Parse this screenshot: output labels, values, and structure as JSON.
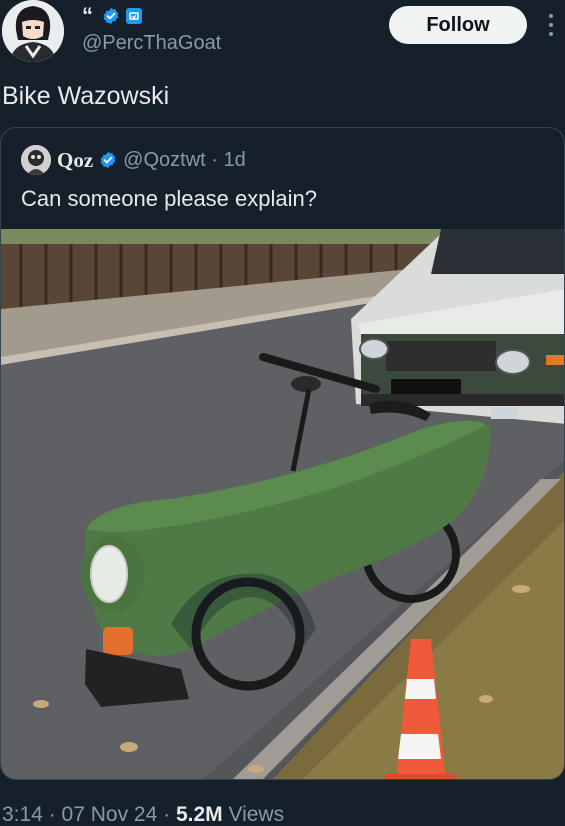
{
  "author": {
    "handle": "@PercThaGoat",
    "badge_icons": [
      "quote-mark-icon",
      "verified-badge-icon",
      "square-badge-icon"
    ],
    "follow_label": "Follow"
  },
  "tweet": {
    "text": "Bike Wazowski"
  },
  "quoted": {
    "name": "Qoz",
    "handle_time": "@Qoztwt · 1d",
    "text": "Can someone please explain?",
    "image": "photo of a green car-front shaped bicycle fairing on a street next to a white car and a traffic cone"
  },
  "meta": {
    "time_date": "3:14 · 07 Nov 24 · ",
    "views_count": "5.2M",
    "views_label": " Views"
  },
  "colors": {
    "background": "#15202b",
    "accent": "#1d9bf0",
    "text": "#e7e9ea",
    "muted": "#8b98a5"
  }
}
